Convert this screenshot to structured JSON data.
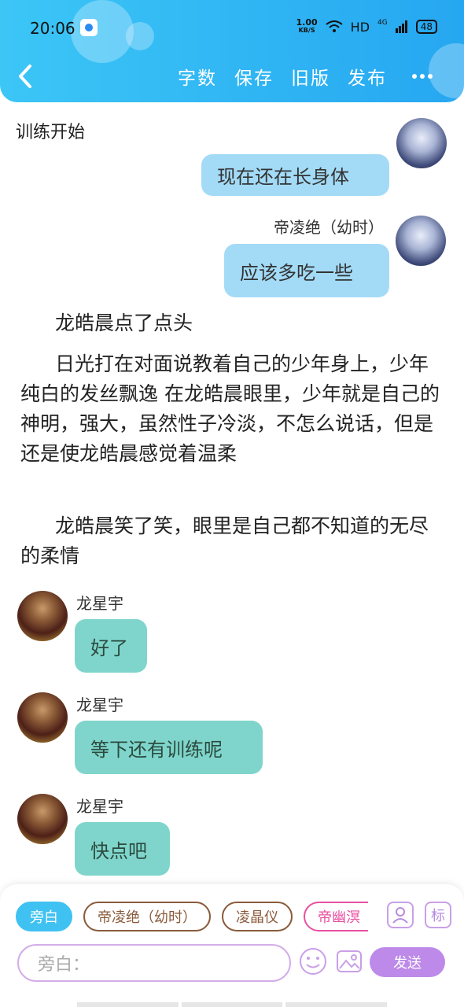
{
  "status_bar": {
    "time": "20:06",
    "speed_value": "1.00",
    "speed_unit": "KB/S",
    "hd": "HD",
    "network": "4G",
    "battery": "48"
  },
  "toolbar": {
    "word_count": "字数",
    "save": "保存",
    "old_version": "旧版",
    "publish": "发布"
  },
  "section_title": "训练开始",
  "messages": [
    {
      "text": "现在还在长身体"
    },
    {
      "speaker": "帝凌绝（幼时）",
      "text": "应该多吃一些"
    },
    {
      "text": "好了"
    },
    {
      "text": "等下还有训练呢"
    },
    {
      "text": "快点吧"
    }
  ],
  "narration": [
    "龙皓晨点了点头",
    "日光打在对面说教着自己的少年身上，少年纯白的发丝飘逸 在龙皓晨眼里，少年就是自己的神明，强大，虽然性子冷淡，不怎么说话，但是还是使龙皓晨感觉着温柔",
    "龙皓晨笑了笑，眼里是自己都不知道的无尽的柔情"
  ],
  "left_speaker": "龙星宇",
  "roles": [
    "旁白",
    "帝凌绝（幼时）",
    "凌晶仪",
    "帝幽溟"
  ],
  "role_icon_label": "标",
  "input_placeholder": "旁白：",
  "send_label": "发送",
  "colors": {
    "header": "#26a7f1",
    "right_bubble": "#a3dbf7",
    "left_bubble": "#7fd5cb",
    "send": "#bd8ae9"
  }
}
